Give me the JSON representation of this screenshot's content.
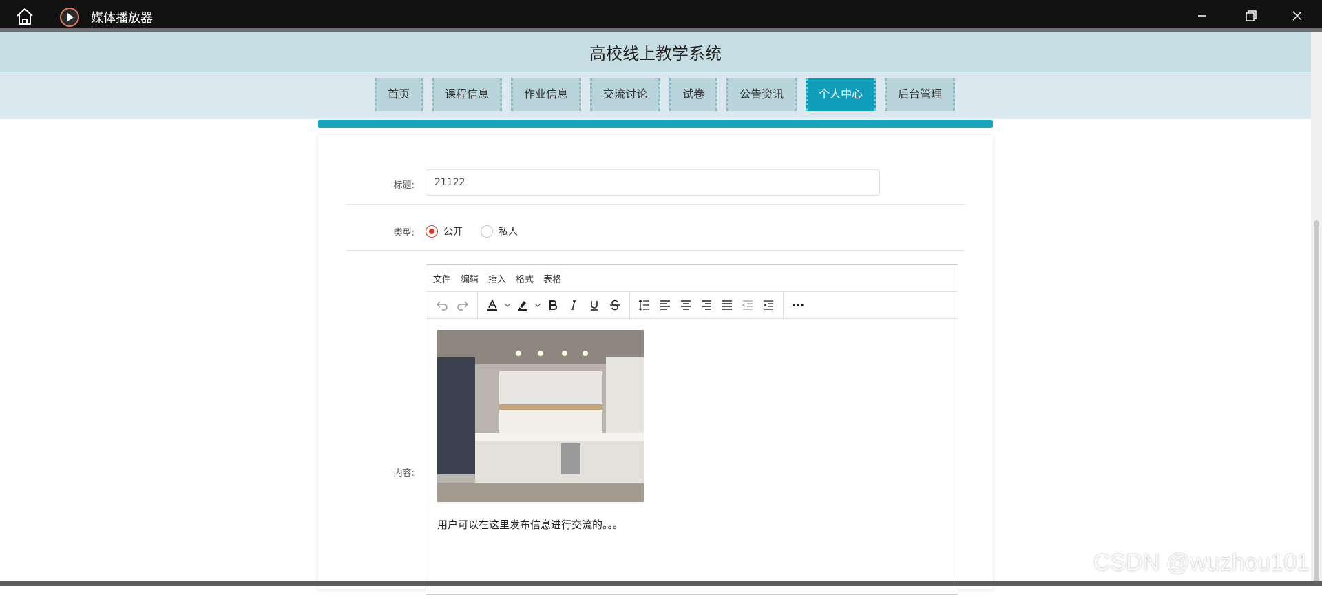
{
  "window": {
    "title": "媒体播放器"
  },
  "site": {
    "title": "高校线上教学系统"
  },
  "nav": {
    "items": [
      "首页",
      "课程信息",
      "作业信息",
      "交流讨论",
      "试卷",
      "公告资讯",
      "个人中心",
      "后台管理"
    ],
    "active": "个人中心"
  },
  "form": {
    "title_label": "标题:",
    "title_value": "21122",
    "type_label": "类型:",
    "type_options": [
      "公开",
      "私人"
    ],
    "type_selected": "公开",
    "content_label": "内容:"
  },
  "editor": {
    "menus": [
      "文件",
      "编辑",
      "插入",
      "格式",
      "表格"
    ],
    "toolbar_icons": [
      "undo-icon",
      "redo-icon",
      "text-color-icon",
      "highlight-icon",
      "bold-icon",
      "italic-icon",
      "underline-icon",
      "strikethrough-icon",
      "line-height-icon",
      "align-left-icon",
      "align-center-icon",
      "align-right-icon",
      "justify-icon",
      "outdent-icon",
      "indent-icon",
      "more-icon"
    ],
    "body_text": "用户可以在这里发布信息进行交流的。。。"
  },
  "watermark": "CSDN @wuzhou101",
  "colors": {
    "accent": "#15a3be",
    "header": "#c6dde3",
    "radio_checked": "#d9352b"
  }
}
